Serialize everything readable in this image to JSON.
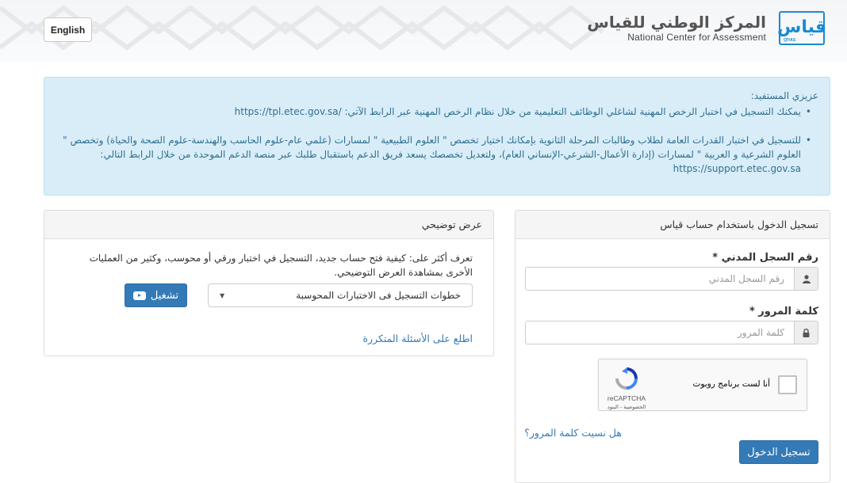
{
  "header": {
    "language_button": "English",
    "logo_arabic": "المركز الوطني للقياس",
    "logo_english": "National Center for Assessment",
    "logo_mark_glyph": "قياس",
    "logo_mark_small": "QIYAS",
    "brand_color": "#1a8ad0"
  },
  "notice": {
    "greeting": "عزيزي المستفيد:",
    "item1_text": "يمكنك التسجيل في اختبار الرخص المهنية لشاغلي الوظائف التعليمية من خلال نظام الرخص المهنية عبر الرابط الآتي:",
    "item1_link": "https://tpl.etec.gov.sa/",
    "item2_text": "للتسجيل في اختبار القدرات العامة لطلاب وطالبات المرحلة الثانوية بإمكانك اختيار تخصص \" العلوم الطبيعية \" لمسارات (علمي عام-علوم الحاسب والهندسة-علوم الصحة والحياة) وتخصص \" العلوم الشرعية و العربية \" لمسارات (إدارة الأعمال-الشرعي-الإنساني العام)، ولتعديل تخصصك يسعد فريق الدعم باستقبال طلبك عبر منصة الدعم الموحدة من خلال الرابط التالي:",
    "item2_link": "https://support.etec.gov.sa",
    "bg_color": "#d8edf8",
    "text_color": "#31708f"
  },
  "demo": {
    "title": "عرض توضيحي",
    "description": "تعرف أكثر على: كيفية فتح حساب جديد، التسجيل في اختبار ورقي أو محوسب، وكثير من العمليات الأخرى بمشاهدة العرض التوضيحي.",
    "select_value": "خطوات التسجيل فى الاختبارات المحوسبة",
    "play_label": "تشغيل",
    "faq_link": "اطلع على الأسئلة المتكررة"
  },
  "login": {
    "title": "تسجيل الدخول باستخدام حساب قياس",
    "id_label": "رقم السجل المدني *",
    "id_placeholder": "رقم السجل المدني",
    "password_label": "كلمة المرور *",
    "password_placeholder": "كلمة المرور",
    "recaptcha_label": "أنا لست برنامج روبوت",
    "recaptcha_brand": "reCAPTCHA",
    "recaptcha_terms": "الخصوصية - البنود",
    "forgot_link": "هل نسيت كلمة المرور؟",
    "submit_label": "تسجيل الدخول",
    "button_color": "#337ab7"
  },
  "icons": {
    "user": "user-icon",
    "lock": "lock-icon",
    "play": "play-icon",
    "caret": "caret-down-icon"
  }
}
